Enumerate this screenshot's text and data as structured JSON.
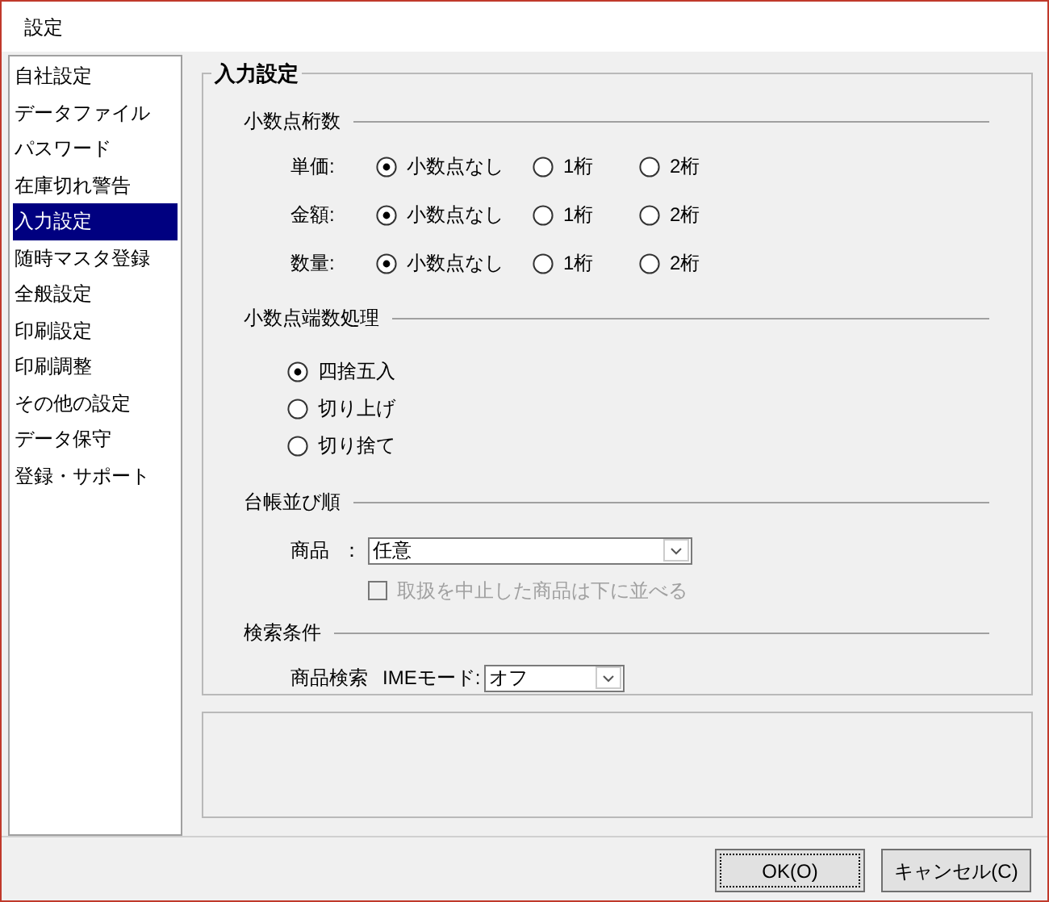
{
  "window": {
    "title": "設定"
  },
  "sidebar": {
    "items": [
      {
        "label": "自社設定",
        "selected": false
      },
      {
        "label": "データファイル",
        "selected": false
      },
      {
        "label": "パスワード",
        "selected": false
      },
      {
        "label": "在庫切れ警告",
        "selected": false
      },
      {
        "label": "入力設定",
        "selected": true
      },
      {
        "label": "随時マスタ登録",
        "selected": false
      },
      {
        "label": "全般設定",
        "selected": false
      },
      {
        "label": "印刷設定",
        "selected": false
      },
      {
        "label": "印刷調整",
        "selected": false
      },
      {
        "label": "その他の設定",
        "selected": false
      },
      {
        "label": "データ保守",
        "selected": false
      },
      {
        "label": "登録・サポート",
        "selected": false
      }
    ]
  },
  "panel": {
    "title": "入力設定",
    "decimal_places": {
      "title": "小数点桁数",
      "rows": [
        {
          "label": "単価:",
          "options": [
            {
              "label": "小数点なし",
              "selected": true
            },
            {
              "label": "1桁",
              "selected": false
            },
            {
              "label": "2桁",
              "selected": false
            }
          ]
        },
        {
          "label": "金額:",
          "options": [
            {
              "label": "小数点なし",
              "selected": true
            },
            {
              "label": "1桁",
              "selected": false
            },
            {
              "label": "2桁",
              "selected": false
            }
          ]
        },
        {
          "label": "数量:",
          "options": [
            {
              "label": "小数点なし",
              "selected": true
            },
            {
              "label": "1桁",
              "selected": false
            },
            {
              "label": "2桁",
              "selected": false
            }
          ]
        }
      ]
    },
    "rounding": {
      "title": "小数点端数処理",
      "options": [
        {
          "label": "四捨五入",
          "selected": true
        },
        {
          "label": "切り上げ",
          "selected": false
        },
        {
          "label": "切り捨て",
          "selected": false
        }
      ]
    },
    "ledger_order": {
      "title": "台帳並び順",
      "product_label": "商品",
      "colon": "：",
      "product_value": "任意",
      "checkbox": {
        "label": "取扱を中止した商品は下に並べる",
        "checked": false,
        "disabled": true
      }
    },
    "search": {
      "title": "検索条件",
      "label": "商品検索",
      "ime_label": "IMEモード:",
      "ime_value": "オフ"
    }
  },
  "buttons": [
    "OK(O)",
    "キャンセル(C)"
  ]
}
